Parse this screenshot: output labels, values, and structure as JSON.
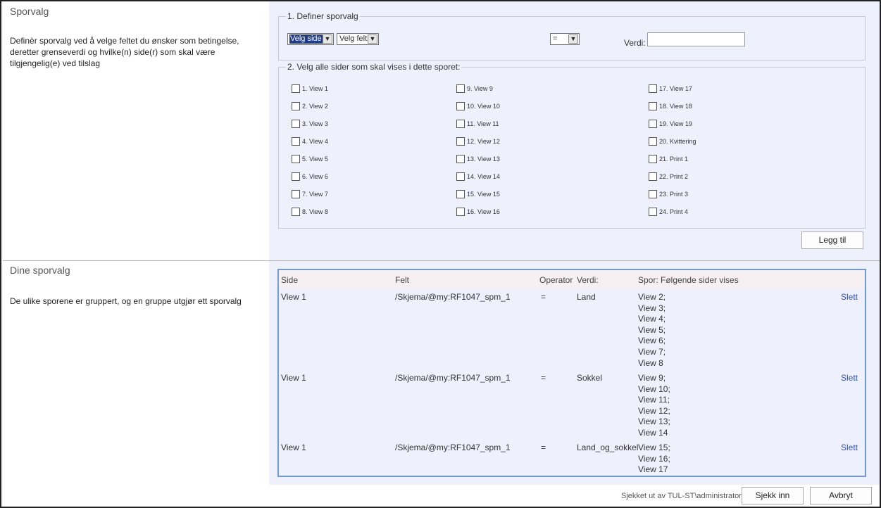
{
  "section1": {
    "title": "Sporvalg",
    "description": "Definèr sporvalg ved å velge feltet du ønsker som betingelse, deretter grenseverdi og hvilke(n) side(r) som skal være tilgjengelig(e) ved tilslag"
  },
  "define": {
    "legend": "1. Definer sporvalg",
    "side_select": "Velg side",
    "field_select": "Velg felt",
    "operator_select": "=",
    "value_label": "Verdi:",
    "value_input": ""
  },
  "pages_group": {
    "legend": "2. Velg alle sider som skal vises i dette sporet:",
    "col1": [
      "1. View 1",
      "2. View 2",
      "3. View 3",
      "4. View 4",
      "5. View 5",
      "6. View 6",
      "7. View 7",
      "8. View 8"
    ],
    "col2": [
      "9. View 9",
      "10. View 10",
      "11. View 11",
      "12. View 12",
      "13. View 13",
      "14. View 14",
      "15. View 15",
      "16. View 16"
    ],
    "col3": [
      "17. View 17",
      "18. View 18",
      "19. View 19",
      "20. Kvittering",
      "21. Print 1",
      "22. Print 2",
      "23. Print 3",
      "24. Print 4"
    ]
  },
  "add_button": "Legg til",
  "section2": {
    "title": "Dine sporvalg",
    "description": "De ulike sporene er gruppert, og en gruppe utgjør ett sporvalg"
  },
  "table": {
    "headers": {
      "side": "Side",
      "felt": "Felt",
      "operator": "Operator",
      "verdi": "Verdi:",
      "spor": "Spor: Følgende sider vises"
    },
    "rows": [
      {
        "side": "View 1",
        "felt": "/Skjema/@my:RF1047_spm_1",
        "operator": "=",
        "verdi": "Land",
        "pages": [
          "View 2;",
          "View 3;",
          "View 4;",
          "View 5;",
          "View 6;",
          "View 7;",
          "View 8"
        ],
        "action": "Slett"
      },
      {
        "side": "View 1",
        "felt": "/Skjema/@my:RF1047_spm_1",
        "operator": "=",
        "verdi": "Sokkel",
        "pages": [
          "View 9;",
          "View 10;",
          "View 11;",
          "View 12;",
          "View 13;",
          "View 14"
        ],
        "action": "Slett"
      },
      {
        "side": "View 1",
        "felt": "/Skjema/@my:RF1047_spm_1",
        "operator": "=",
        "verdi": "Land_og_sokkel",
        "pages": [
          "View 15;",
          "View 16;",
          "View 17"
        ],
        "action": "Slett"
      }
    ]
  },
  "footer": {
    "checked_out": "Sjekket ut av TUL-ST\\administrator",
    "checkin_button": "Sjekk inn",
    "cancel_button": "Avbryt"
  }
}
